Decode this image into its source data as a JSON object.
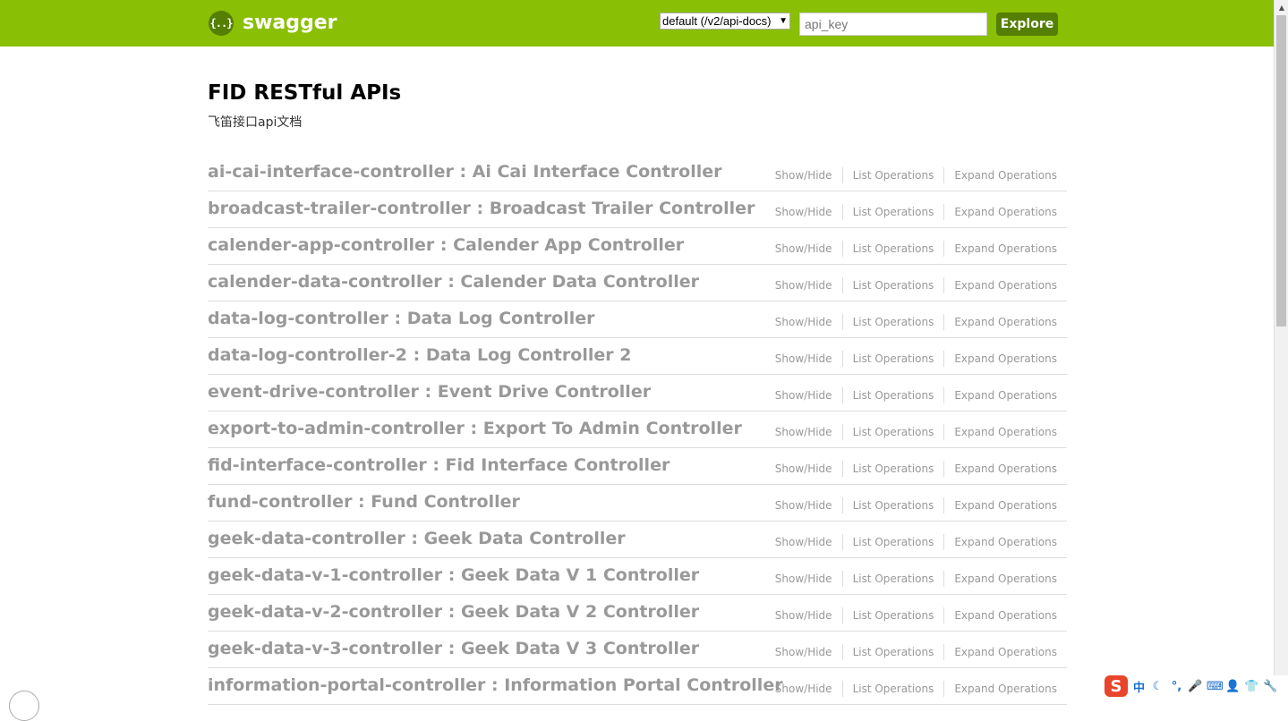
{
  "header": {
    "logo_glyph": "{..}",
    "logo_text": "swagger",
    "spec_select_value": "default (/v2/api-docs)",
    "api_key_placeholder": "api_key",
    "explore_label": "Explore"
  },
  "info": {
    "title": "FID RESTful APIs",
    "description": "飞笛接口api文档"
  },
  "options": {
    "show_hide": "Show/Hide",
    "list_operations": "List Operations",
    "expand_operations": "Expand Operations"
  },
  "resources": [
    {
      "title": "ai-cai-interface-controller : Ai Cai Interface Controller"
    },
    {
      "title": "broadcast-trailer-controller : Broadcast Trailer Controller"
    },
    {
      "title": "calender-app-controller : Calender App Controller"
    },
    {
      "title": "calender-data-controller : Calender Data Controller"
    },
    {
      "title": "data-log-controller : Data Log Controller"
    },
    {
      "title": "data-log-controller-2 : Data Log Controller 2"
    },
    {
      "title": "event-drive-controller : Event Drive Controller"
    },
    {
      "title": "export-to-admin-controller : Export To Admin Controller"
    },
    {
      "title": "fid-interface-controller : Fid Interface Controller"
    },
    {
      "title": "fund-controller : Fund Controller"
    },
    {
      "title": "geek-data-controller : Geek Data Controller"
    },
    {
      "title": "geek-data-v-1-controller : Geek Data V 1 Controller"
    },
    {
      "title": "geek-data-v-2-controller : Geek Data V 2 Controller"
    },
    {
      "title": "geek-data-v-3-controller : Geek Data V 3 Controller"
    },
    {
      "title": "information-portal-controller : Information Portal Controller"
    }
  ],
  "tray": {
    "ime_logo": "S",
    "ime_mode": "中"
  },
  "colors": {
    "header_bg": "#89bf04",
    "button_bg": "#547f00",
    "resource_text": "#999999"
  }
}
